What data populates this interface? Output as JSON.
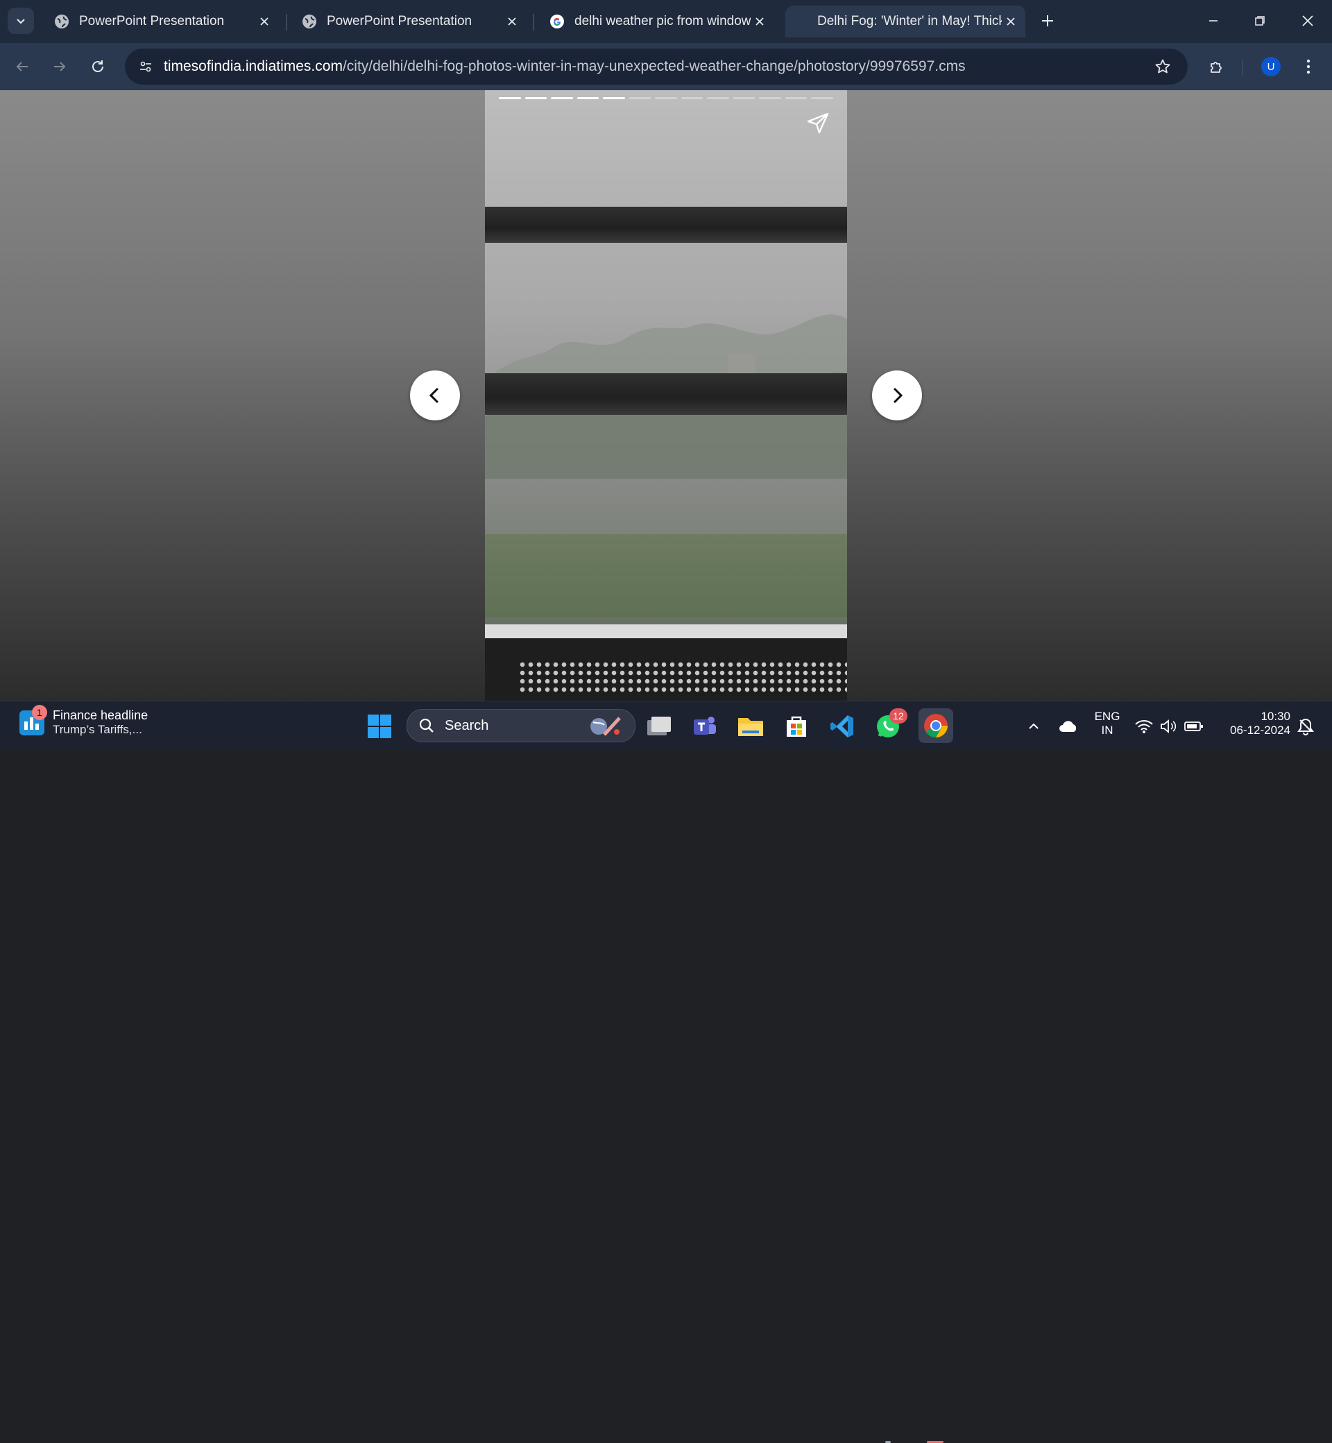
{
  "browser": {
    "tabs": [
      {
        "title": "PowerPoint Presentation",
        "favicon": "globe-icon"
      },
      {
        "title": "PowerPoint Presentation",
        "favicon": "globe-icon"
      },
      {
        "title": "delhi weather pic from window",
        "favicon": "google-icon"
      },
      {
        "title": "Delhi Fog: 'Winter' in May! Thick",
        "favicon": "none",
        "active": true
      }
    ],
    "url_host": "timesofindia.indiatimes.com",
    "url_path": "/city/delhi/delhi-fog-photos-winter-in-may-unexpected-weather-change/photostory/99976597.cms",
    "profile_initial": "U"
  },
  "story": {
    "total_segments": 13,
    "completed_segments": 5
  },
  "taskbar": {
    "news_headline": "Finance headline",
    "news_subtext": "Trump’s Tariffs,...",
    "news_badge": "1",
    "search_label": "Search",
    "whatsapp_badge": "12",
    "language": "ENG",
    "region": "IN",
    "time": "10:30",
    "date": "06-12-2024"
  },
  "colors": {
    "tabbar": "#1f2a3d",
    "toolbar": "#2b3950",
    "taskbar": "#1d2231",
    "chrome_accent": "#0b57d0"
  }
}
